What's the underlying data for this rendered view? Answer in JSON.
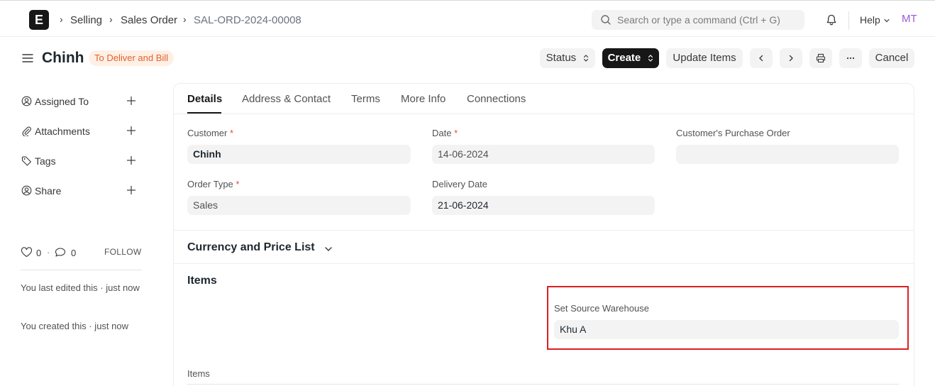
{
  "navbar": {
    "logo_letter": "E",
    "breadcrumbs": [
      "Selling",
      "Sales Order",
      "SAL-ORD-2024-00008"
    ],
    "search_placeholder": "Search or type a command (Ctrl + G)",
    "help_label": "Help",
    "avatar_initials": "MT"
  },
  "page": {
    "title": "Chinh",
    "status": "To Deliver and Bill",
    "buttons": {
      "status": "Status",
      "create": "Create",
      "update_items": "Update Items",
      "cancel": "Cancel"
    }
  },
  "sidebar": {
    "items": [
      {
        "label": "Assigned To",
        "icon": "user-circle-icon"
      },
      {
        "label": "Attachments",
        "icon": "paperclip-icon"
      },
      {
        "label": "Tags",
        "icon": "tag-icon"
      },
      {
        "label": "Share",
        "icon": "share-user-icon"
      }
    ],
    "likes": "0",
    "comments": "0",
    "follow_label": "FOLLOW",
    "activity": [
      "You last edited this · just now",
      "You created this · just now"
    ]
  },
  "tabs": [
    "Details",
    "Address & Contact",
    "Terms",
    "More Info",
    "Connections"
  ],
  "form": {
    "customer_label": "Customer",
    "customer_value": "Chinh",
    "date_label": "Date",
    "date_value": "14-06-2024",
    "po_label": "Customer's Purchase Order",
    "po_value": "",
    "order_type_label": "Order Type",
    "order_type_value": "Sales",
    "delivery_date_label": "Delivery Date",
    "delivery_date_value": "21-06-2024",
    "required_mark": "*"
  },
  "sections": {
    "currency_title": "Currency and Price List",
    "items_title": "Items",
    "warehouse_label": "Set Source Warehouse",
    "warehouse_value": "Khu A",
    "items_table_label": "Items"
  },
  "colors": {
    "status_bg": "#fff0e6",
    "status_text": "#e2612c",
    "highlight_border": "#dd1f24",
    "avatar": "#9c5ad6"
  }
}
